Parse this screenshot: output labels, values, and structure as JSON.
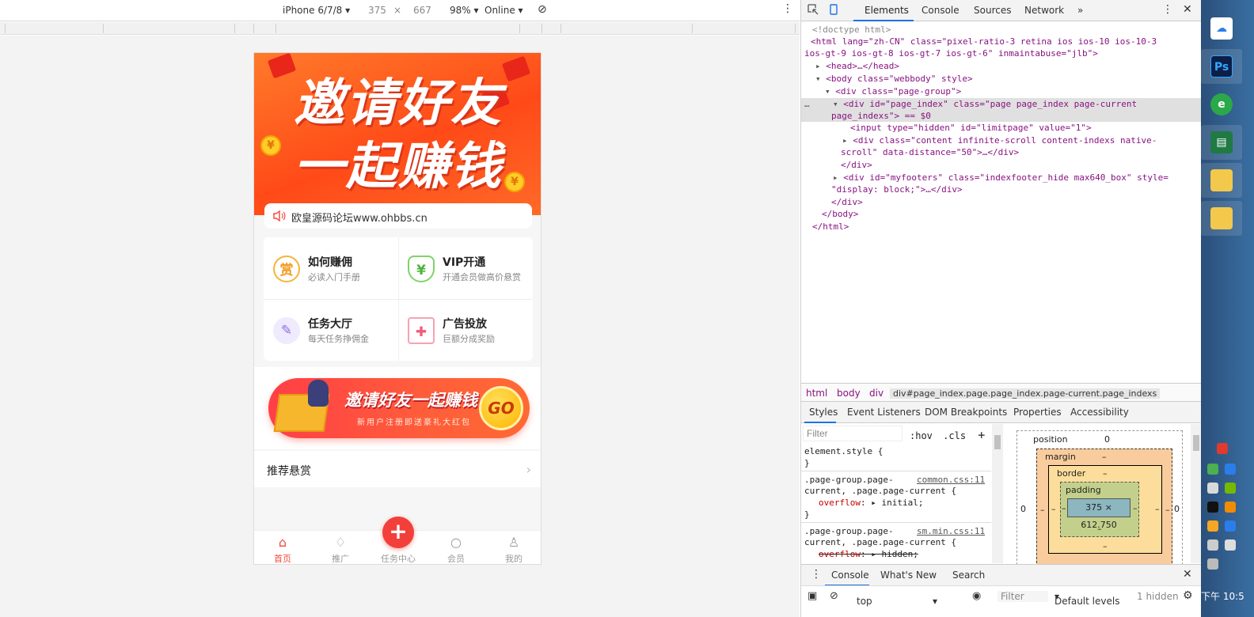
{
  "device_toolbar": {
    "device": "iPhone 6/7/8",
    "width": "375",
    "times": "×",
    "height": "667",
    "zoom": "98%",
    "network": "Online"
  },
  "app": {
    "hero": {
      "line1": "邀请好友",
      "line2": "一起赚钱",
      "coin": "¥"
    },
    "notice": "欧皇源码论坛www.ohbbs.cn",
    "features": [
      {
        "icon_char": "赏",
        "title": "如何赚佣",
        "subtitle": "必读入门手册"
      },
      {
        "icon_char": "¥",
        "title": "VIP开通",
        "subtitle": "开通会员做高价悬赏"
      },
      {
        "icon_char": "✎",
        "title": "任务大厅",
        "subtitle": "每天任务挣佣金"
      },
      {
        "icon_char": "✚",
        "title": "广告投放",
        "subtitle": "巨额分成奖励"
      }
    ],
    "banner": {
      "title": "邀请好友一起赚钱",
      "subtitle": "新用户注册即送豪礼大红包",
      "go": "GO"
    },
    "recommend": {
      "label": "推荐悬赏",
      "chevron": "›"
    },
    "tabbar": [
      {
        "label": "首页",
        "icon": "home-icon",
        "glyph": "⌂"
      },
      {
        "label": "推广",
        "icon": "bell-icon",
        "glyph": "♢"
      },
      {
        "label": "任务中心",
        "icon": "plus-icon",
        "glyph": "+"
      },
      {
        "label": "会员",
        "icon": "search-icon",
        "glyph": "○"
      },
      {
        "label": "我的",
        "icon": "user-icon",
        "glyph": "♙"
      }
    ],
    "colors": {
      "accent": "#f2483a",
      "hero": "#ff5a1f"
    }
  },
  "devtools": {
    "tabs": [
      "Elements",
      "Console",
      "Sources",
      "Network",
      "»"
    ],
    "dom": {
      "doctype": "<!doctype html>",
      "html_open": "<html lang=\"zh-CN\" class=\"pixel-ratio-3 retina ios ios-10 ios-10-3",
      "html_open2": "ios-gt-9 ios-gt-8 ios-gt-7 ios-gt-6\" inmaintabuse=\"jlb\">",
      "head": "<head>…</head>",
      "body": "<body class=\"webbody\" style>",
      "pagegroup": "<div class=\"page-group\">",
      "pageindex": "<div id=\"page_index\" class=\"page page_index page-current",
      "pageindex2": "page_indexs\"> == $0",
      "input": "<input type=\"hidden\" id=\"limitpage\" value=\"1\">",
      "content": "<div class=\"content infinite-scroll content-indexs native-",
      "content2": "scroll\" data-distance=\"50\">…</div>",
      "close_div": "</div>",
      "footers": "<div id=\"myfooters\" class=\"indexfooter_hide max640_box\" style=",
      "footers2": "\"display: block;\">…</div>",
      "close_div2": "</div>",
      "close_body": "</body>",
      "close_html": "</html>"
    },
    "breadcrumbs": [
      "html",
      "body",
      "div",
      "div#page_index.page.page_index.page-current.page_indexs"
    ],
    "subtabs": [
      "Styles",
      "Event Listeners",
      "DOM Breakpoints",
      "Properties",
      "Accessibility"
    ],
    "styles": {
      "filter_placeholder": "Filter",
      "hov": ":hov",
      "cls": ".cls",
      "plus": "+",
      "rules": [
        {
          "l1": "element.style {",
          "l2": "}"
        },
        {
          "sel": ".page-group.page-",
          "src": "common.css:11",
          "sel2": "current, .page.page-current {",
          "prop": "overflow",
          "val": "▸ initial;",
          "end": "}"
        },
        {
          "sel": ".page-group.page-",
          "src": "sm.min.css:11",
          "sel2": "current, .page.page-current {",
          "prop": "overflow",
          "val": "▸ hidden;"
        }
      ]
    },
    "boxmodel": {
      "position": "position",
      "position_val": "0",
      "margin": "margin",
      "border": "border",
      "padding": "padding",
      "dash": "–",
      "content": "375 × 612.750",
      "zero": "0"
    },
    "drawer": {
      "tabs": [
        "Console",
        "What's New",
        "Search"
      ],
      "close": "✕"
    },
    "console": {
      "context": "top",
      "filter": "Filter",
      "levels": "Default levels",
      "hidden": "1 hidden"
    }
  },
  "taskbar": {
    "clock": "下午 10:5"
  }
}
